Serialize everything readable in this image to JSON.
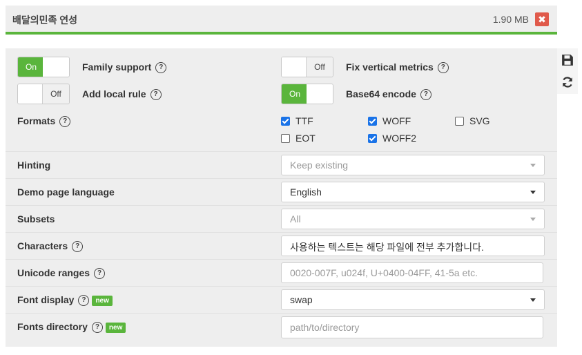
{
  "header": {
    "title": "배달의민족 연성",
    "size": "1.90 MB",
    "close_icon": "close-icon"
  },
  "sidetools": {
    "save_icon": "save-icon",
    "refresh_icon": "refresh-icon"
  },
  "toggles": {
    "family_support": {
      "label": "Family support",
      "state": "On",
      "on_text": "On",
      "off_text": ""
    },
    "add_local_rule": {
      "label": "Add local rule",
      "state": "Off",
      "on_text": "",
      "off_text": "Off"
    },
    "fix_vertical": {
      "label": "Fix vertical metrics",
      "state": "Off",
      "on_text": "",
      "off_text": "Off"
    },
    "base64": {
      "label": "Base64 encode",
      "state": "On",
      "on_text": "On",
      "off_text": ""
    }
  },
  "formats": {
    "label": "Formats",
    "options": [
      {
        "name": "TTF",
        "checked": true
      },
      {
        "name": "WOFF",
        "checked": true
      },
      {
        "name": "SVG",
        "checked": false
      },
      {
        "name": "EOT",
        "checked": false
      },
      {
        "name": "WOFF2",
        "checked": true
      }
    ]
  },
  "hinting": {
    "label": "Hinting",
    "value": "Keep existing"
  },
  "demo_lang": {
    "label": "Demo page language",
    "value": "English"
  },
  "subsets": {
    "label": "Subsets",
    "value": "All"
  },
  "characters": {
    "label": "Characters",
    "value": "사용하는 텍스트는 해당 파일에 전부 추가합니다."
  },
  "unicode": {
    "label": "Unicode ranges",
    "placeholder": "0020-007F, u024f, U+0400-04FF, 41-5a etc."
  },
  "font_display": {
    "label": "Font display",
    "badge": "new",
    "value": "swap"
  },
  "fonts_dir": {
    "label": "Fonts directory",
    "badge": "new",
    "placeholder": "path/to/directory"
  },
  "help_glyph": "?"
}
